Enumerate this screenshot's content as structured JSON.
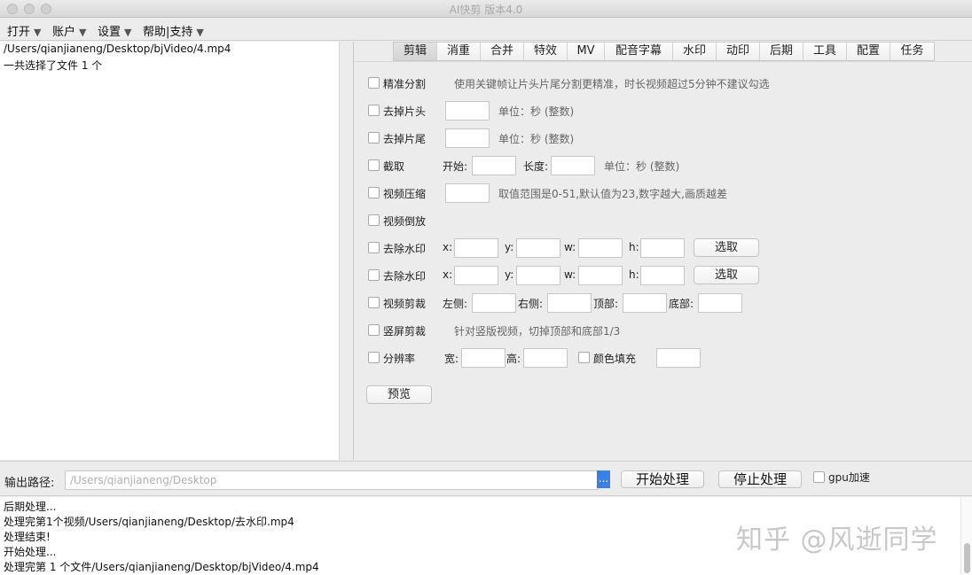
{
  "window": {
    "title": "AI快剪  版本4.0"
  },
  "menu": [
    {
      "label": "打开"
    },
    {
      "label": "账户"
    },
    {
      "label": "设置"
    },
    {
      "label": "帮助|支持"
    }
  ],
  "left": {
    "file_path": "/Users/qianjianeng/Desktop/bjVideo/4.mp4",
    "summary": "一共选择了文件 1 个"
  },
  "tabs": [
    "剪辑",
    "消重",
    "合并",
    "特效",
    "MV",
    "配音字幕",
    "水印",
    "动印",
    "后期",
    "工具",
    "配置",
    "任务"
  ],
  "active_tab": "剪辑",
  "form": {
    "precise_split": {
      "label": "精准分割",
      "hint": "使用关键帧让片头片尾分割更精准，时长视频超过5分钟不建议勾选"
    },
    "remove_head": {
      "label": "去掉片头",
      "hint": "单位：秒 (整数)"
    },
    "remove_tail": {
      "label": "去掉片尾",
      "hint": "单位：秒 (整数)"
    },
    "clip": {
      "label": "截取",
      "start": "开始:",
      "length": "长度:",
      "hint": "单位：秒 (整数)"
    },
    "compress": {
      "label": "视频压缩",
      "hint": "取值范围是0-51,默认值为23,数字越大,画质越差"
    },
    "reverse": {
      "label": "视频倒放"
    },
    "watermark1": {
      "label": "去除水印",
      "x": "x:",
      "y": "y:",
      "w": "w:",
      "h": "h:",
      "button": "选取"
    },
    "watermark2": {
      "label": "去除水印",
      "x": "x:",
      "y": "y:",
      "w": "w:",
      "h": "h:",
      "button": "选取"
    },
    "crop": {
      "label": "视频剪裁",
      "left": "左侧:",
      "right": "右侧:",
      "top": "顶部:",
      "bottom": "底部:"
    },
    "vertical_crop": {
      "label": "竖屏剪裁",
      "hint": "针对竖版视频，切掉顶部和底部1/3"
    },
    "resolution": {
      "label": "分辨率",
      "width": "宽:",
      "height": "高:",
      "fill_label": "颜色填充"
    },
    "preview_button": "预览"
  },
  "output": {
    "label": "输出路径:",
    "path": "/Users/qianjianeng/Desktop",
    "browse": "...",
    "start_button": "开始处理",
    "stop_button": "停止处理",
    "gpu_label": "gpu加速"
  },
  "log": [
    "后期处理...",
    "处理完第1个视频/Users/qianjianeng/Desktop/去水印.mp4",
    "处理结束!",
    "开始处理...",
    "处理完第 1 个文件/Users/qianjianeng/Desktop/bjVideo/4.mp4"
  ],
  "watermark": "知乎 @风逝同学",
  "colors": {
    "accent": "#3b7fe8",
    "background": "#ececec"
  }
}
